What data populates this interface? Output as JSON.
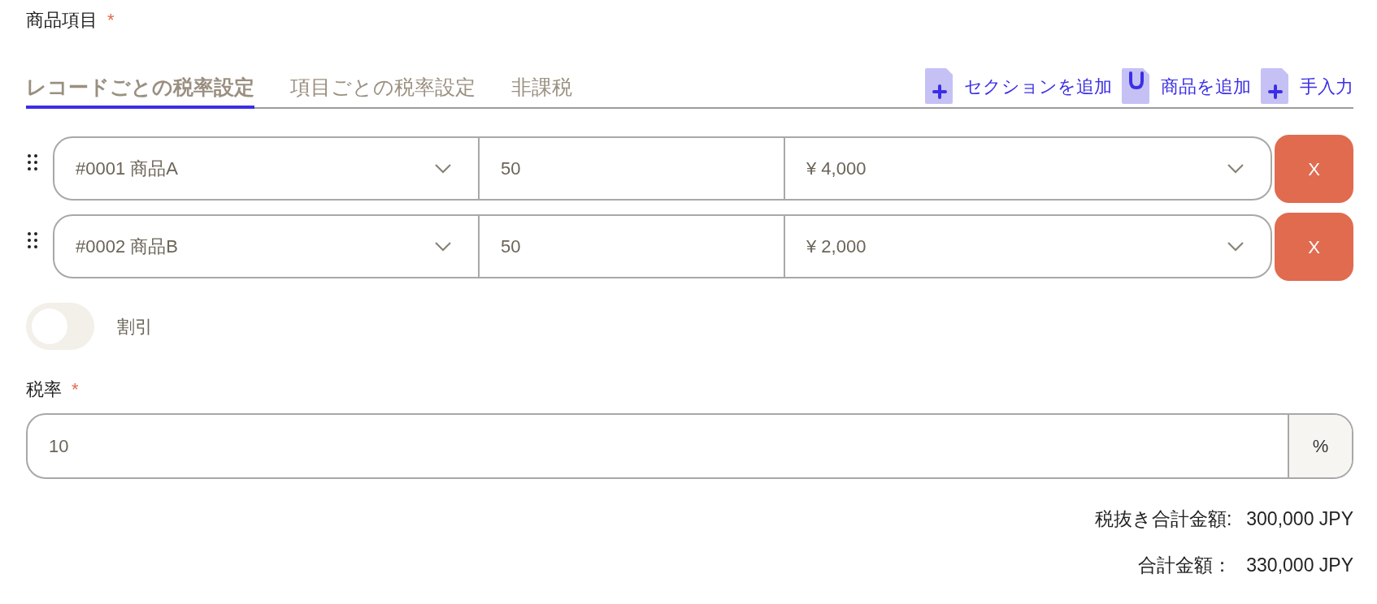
{
  "field_label": {
    "text": "商品項目",
    "required_mark": "*"
  },
  "tabs": [
    {
      "label": "レコードごとの税率設定",
      "selected": true
    },
    {
      "label": "項目ごとの税率設定",
      "selected": false
    },
    {
      "label": "非課税",
      "selected": false
    }
  ],
  "actions": [
    {
      "kind": "document-plus",
      "label": "セクションを追加"
    },
    {
      "kind": "document-u",
      "label": "商品を追加"
    },
    {
      "kind": "document-plus",
      "label": "手入力"
    }
  ],
  "rows": [
    {
      "product": "#0001 商品A",
      "quantity": "50",
      "price": "¥ 4,000",
      "remove": "X"
    },
    {
      "product": "#0002 商品B",
      "quantity": "50",
      "price": "¥ 2,000",
      "remove": "X"
    }
  ],
  "discount": {
    "on": false,
    "label": "割引"
  },
  "tax_rate": {
    "label": "税率",
    "required_mark": "*",
    "value": "10",
    "unit": "%"
  },
  "totals": [
    {
      "label": "税抜き合計金額:",
      "value": "300,000 JPY"
    },
    {
      "label": "合計金額：",
      "value": "330,000 JPY"
    }
  ]
}
